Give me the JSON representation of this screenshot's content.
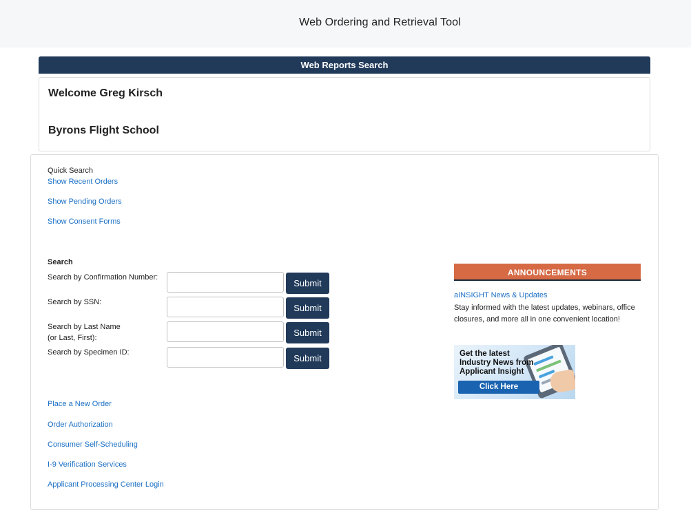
{
  "header": {
    "title": "Web Ordering and Retrieval Tool"
  },
  "section": {
    "title": "Web Reports Search"
  },
  "welcome": {
    "greeting": "Welcome Greg Kirsch",
    "company": "Byrons Flight School"
  },
  "quick_search": {
    "label": "Quick Search",
    "links": [
      "Show Recent Orders",
      "Show Pending Orders",
      "Show Consent Forms"
    ]
  },
  "search": {
    "heading": "Search",
    "rows": [
      {
        "label": "Search by Confirmation Number:",
        "value": "",
        "button": "Submit"
      },
      {
        "label": "Search by SSN:",
        "value": "",
        "button": "Submit"
      },
      {
        "label": "Search by Last Name",
        "label2": "(or Last, First):",
        "value": "",
        "button": "Submit"
      },
      {
        "label": "Search by Specimen ID:",
        "value": "",
        "button": "Submit"
      }
    ]
  },
  "bottom_links": [
    "Place a New Order",
    "Order Authorization",
    "Consumer Self-Scheduling",
    "I-9 Verification Services",
    "Applicant Processing Center Login"
  ],
  "announcements": {
    "title": "ANNOUNCEMENTS",
    "link": "aINSIGHT News & Updates",
    "text": "Stay informed with the latest updates, webinars, office closures, and more all in one convenient location!",
    "banner": {
      "line1": "Get the latest",
      "line2": "Industry News from",
      "line3": "Applicant Insight",
      "button": "Click Here"
    }
  },
  "colors": {
    "navy": "#213a5a",
    "link": "#1a6fc4",
    "announcement": "#d66a45"
  }
}
